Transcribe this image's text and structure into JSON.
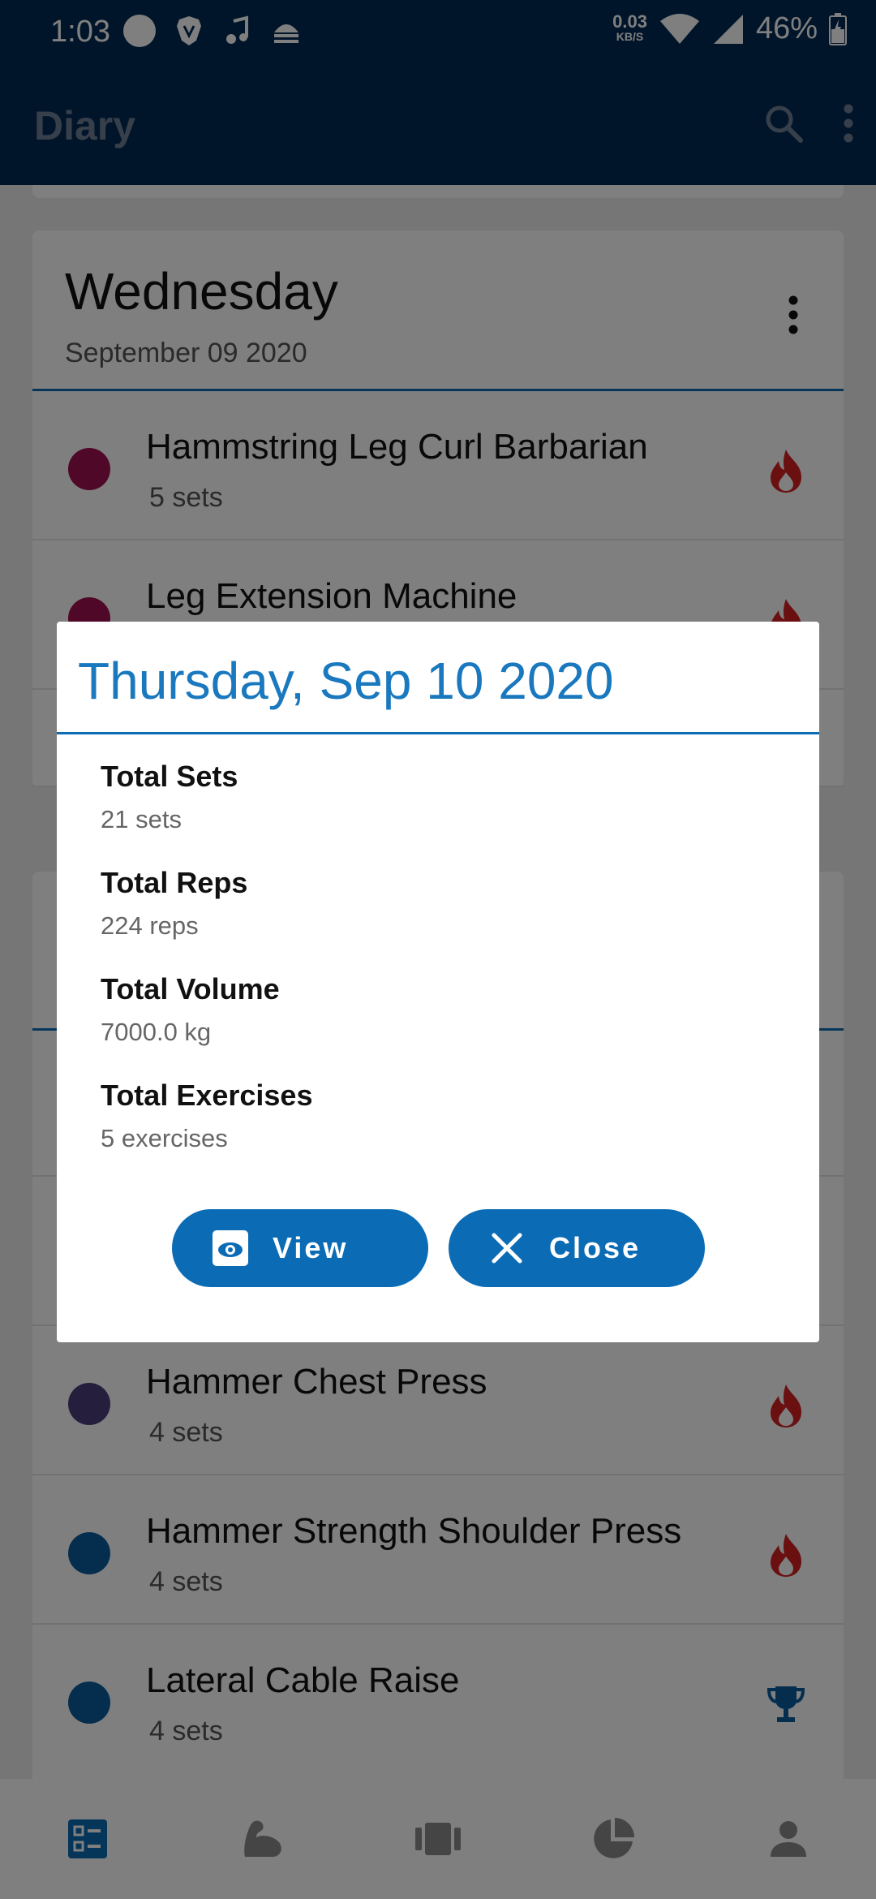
{
  "status_bar": {
    "time": "1:03",
    "net_speed": "0.03",
    "net_speed_unit": "KB/S",
    "battery": "46%"
  },
  "app_bar": {
    "title": "Diary",
    "search_icon": "search-icon",
    "overflow_icon": "more-vert-icon"
  },
  "day_cards": [
    {
      "day": "Wednesday",
      "date": "September 09 2020",
      "exercises": [
        {
          "name": "Hammstring Leg Curl Barbarian",
          "sets": "5 sets",
          "dot_color": "#a11050",
          "icon": "fire-icon"
        },
        {
          "name": "Leg Extension Machine",
          "sets": "",
          "dot_color": "#a11050",
          "icon": "fire-icon"
        }
      ]
    },
    {
      "day": "",
      "date": "",
      "exercises": [
        {
          "name": "Hammer Chest Press",
          "sets": "4 sets",
          "dot_color": "#4a3f7a",
          "icon": "fire-icon"
        },
        {
          "name": "Hammer Strength Shoulder Press",
          "sets": "4 sets",
          "dot_color": "#0a5c9c",
          "icon": "fire-icon"
        },
        {
          "name": "Lateral Cable Raise",
          "sets": "4 sets",
          "dot_color": "#0a5c9c",
          "icon": "trophy-icon"
        }
      ]
    }
  ],
  "dialog": {
    "title": "Thursday, Sep 10 2020",
    "stats": [
      {
        "label": "Total Sets",
        "value": "21 sets"
      },
      {
        "label": "Total Reps",
        "value": "224 reps"
      },
      {
        "label": "Total Volume",
        "value": "7000.0 kg"
      },
      {
        "label": "Total Exercises",
        "value": "5 exercises"
      }
    ],
    "view_label": "View",
    "close_label": "Close"
  },
  "bottom_nav": {
    "items": [
      "diary-icon",
      "muscle-icon",
      "routine-icon",
      "stats-pie-icon",
      "profile-icon"
    ],
    "active_index": 0
  },
  "colors": {
    "primary_dark": "#022b55",
    "accent": "#0b6cb5",
    "fire": "#d42020"
  }
}
